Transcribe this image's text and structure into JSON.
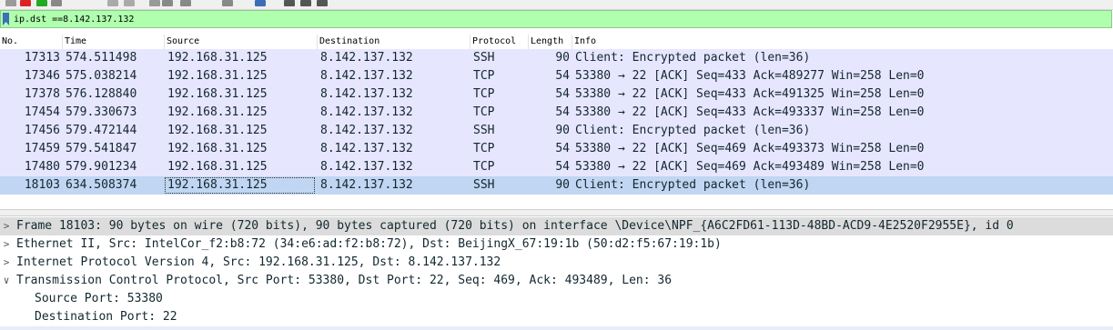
{
  "toolbar": {
    "icons": [
      "open-icon",
      "close-file-icon",
      "save-icon",
      "reload-icon",
      "go-back-icon",
      "go-forward-icon",
      "go-to-packet-icon",
      "first-packet-icon",
      "last-packet-icon",
      "autoscroll-icon",
      "colorize-icon",
      "zoom-in-icon",
      "zoom-out-icon",
      "zoom-reset-icon"
    ]
  },
  "filter": {
    "value": "ip.dst ==8.142.137.132"
  },
  "columns": [
    "No.",
    "Time",
    "Source",
    "Destination",
    "Protocol",
    "Length",
    "Info"
  ],
  "packets": [
    {
      "no": "17313",
      "time": "574.511498",
      "src": "192.168.31.125",
      "dst": "8.142.137.132",
      "proto": "SSH",
      "len": "90",
      "info": "Client: Encrypted packet (len=36)"
    },
    {
      "no": "17346",
      "time": "575.038214",
      "src": "192.168.31.125",
      "dst": "8.142.137.132",
      "proto": "TCP",
      "len": "54",
      "info": "53380 → 22 [ACK] Seq=433 Ack=489277 Win=258 Len=0"
    },
    {
      "no": "17378",
      "time": "576.128840",
      "src": "192.168.31.125",
      "dst": "8.142.137.132",
      "proto": "TCP",
      "len": "54",
      "info": "53380 → 22 [ACK] Seq=433 Ack=491325 Win=258 Len=0"
    },
    {
      "no": "17454",
      "time": "579.330673",
      "src": "192.168.31.125",
      "dst": "8.142.137.132",
      "proto": "TCP",
      "len": "54",
      "info": "53380 → 22 [ACK] Seq=433 Ack=493337 Win=258 Len=0"
    },
    {
      "no": "17456",
      "time": "579.472144",
      "src": "192.168.31.125",
      "dst": "8.142.137.132",
      "proto": "SSH",
      "len": "90",
      "info": "Client: Encrypted packet (len=36)"
    },
    {
      "no": "17459",
      "time": "579.541847",
      "src": "192.168.31.125",
      "dst": "8.142.137.132",
      "proto": "TCP",
      "len": "54",
      "info": "53380 → 22 [ACK] Seq=469 Ack=493373 Win=258 Len=0"
    },
    {
      "no": "17480",
      "time": "579.901234",
      "src": "192.168.31.125",
      "dst": "8.142.137.132",
      "proto": "TCP",
      "len": "54",
      "info": "53380 → 22 [ACK] Seq=469 Ack=493489 Win=258 Len=0"
    },
    {
      "no": "18103",
      "time": "634.508374",
      "src": "192.168.31.125",
      "dst": "8.142.137.132",
      "proto": "SSH",
      "len": "90",
      "info": "Client: Encrypted packet (len=36)"
    }
  ],
  "selected_packet_index": 7,
  "details": [
    {
      "text": "Frame 18103: 90 bytes on wire (720 bits), 90 bytes captured (720 bits) on interface \\Device\\NPF_{A6C2FD61-113D-48BD-ACD9-4E2520F2955E}, id 0",
      "expanded": false,
      "child": false
    },
    {
      "text": "Ethernet II, Src: IntelCor_f2:b8:72 (34:e6:ad:f2:b8:72), Dst: BeijingX_67:19:1b (50:d2:f5:67:19:1b)",
      "expanded": false,
      "child": false
    },
    {
      "text": "Internet Protocol Version 4, Src: 192.168.31.125, Dst: 8.142.137.132",
      "expanded": false,
      "child": false
    },
    {
      "text": "Transmission Control Protocol, Src Port: 53380, Dst Port: 22, Seq: 469, Ack: 493489, Len: 36",
      "expanded": true,
      "child": false
    },
    {
      "text": "Source Port: 53380",
      "expanded": null,
      "child": true
    },
    {
      "text": "Destination Port: 22",
      "expanded": null,
      "child": true
    }
  ],
  "colors": {
    "filter_valid_bg": "#afffaf",
    "row_bg": "#e7e6ff",
    "row_selected_bg": "#c0d6f2",
    "detail_highlight_bg": "#dcdcdc"
  }
}
